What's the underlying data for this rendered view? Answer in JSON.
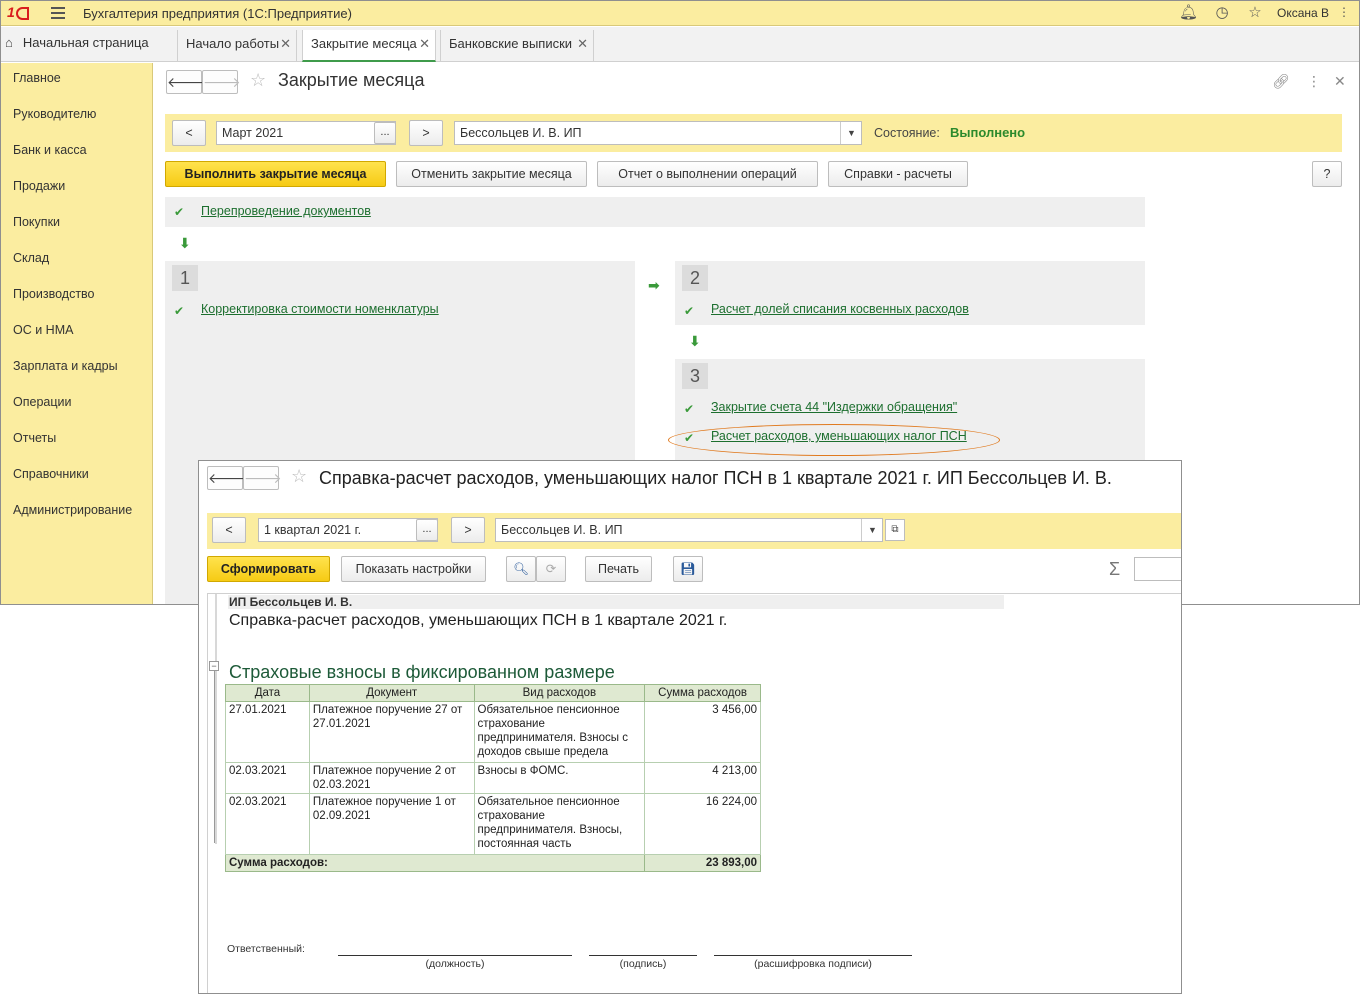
{
  "app": {
    "title": "Бухгалтерия предприятия  (1С:Предприятие)",
    "user": "Оксана В"
  },
  "tabs": [
    {
      "label": "Начальная страница"
    },
    {
      "label": "Начало работы"
    },
    {
      "label": "Закрытие месяца"
    },
    {
      "label": "Банковские выписки"
    }
  ],
  "sidebar": {
    "items": [
      {
        "label": "Главное"
      },
      {
        "label": "Руководителю"
      },
      {
        "label": "Банк и касса"
      },
      {
        "label": "Продажи"
      },
      {
        "label": "Покупки"
      },
      {
        "label": "Склад"
      },
      {
        "label": "Производство"
      },
      {
        "label": "ОС и НМА"
      },
      {
        "label": "Зарплата и кадры"
      },
      {
        "label": "Операции"
      },
      {
        "label": "Отчеты"
      },
      {
        "label": "Справочники"
      },
      {
        "label": "Администрирование"
      }
    ]
  },
  "closing": {
    "title": "Закрытие месяца",
    "period": "Март 2021",
    "organization": "Бессольцев И. В. ИП",
    "status_label": "Состояние:",
    "status_value": "Выполнено",
    "buttons": {
      "run": "Выполнить закрытие месяца",
      "cancel": "Отменить закрытие месяца",
      "report": "Отчет о выполнении операций",
      "refs": "Справки - расчеты",
      "help": "?"
    },
    "prev": "<",
    "next": ">",
    "ellipsis": "...",
    "step0": {
      "op": "Перепроведение документов"
    },
    "step1": {
      "num": "1",
      "op": "Корректировка стоимости номенклатуры"
    },
    "step2": {
      "num": "2",
      "op": "Расчет долей списания косвенных расходов"
    },
    "step3": {
      "num": "3",
      "ops": [
        "Закрытие счета 44 \"Издержки обращения\"",
        "Расчет расходов, уменьшающих налог ПСН"
      ]
    }
  },
  "report": {
    "window_title": "Справка-расчет расходов, уменьшающих налог ПСН в 1 квартале 2021 г. ИП Бессольцев И. В.",
    "period": "1 квартал 2021 г.",
    "organization": "Бессольцев И. В. ИП",
    "buttons": {
      "generate": "Сформировать",
      "settings": "Показать настройки",
      "print": "Печать"
    },
    "prev": "<",
    "next": ">",
    "ellipsis": "...",
    "org_header": "ИП Бессольцев И. В.",
    "doc_title": "Справка-расчет расходов, уменьшающих ПСН в 1 квартале 2021 г.",
    "section_title": "Страховые взносы в фиксированном размере",
    "columns": [
      "Дата",
      "Документ",
      "Вид расходов",
      "Сумма расходов"
    ],
    "rows": [
      {
        "date": "27.01.2021",
        "doc": "Платежное поручение 27 от 27.01.2021",
        "kind": "Обязательное пенсионное страхование предпринимателя. Взносы с доходов свыше предела",
        "sum": "3 456,00"
      },
      {
        "date": "02.03.2021",
        "doc": "Платежное поручение 2 от 02.03.2021",
        "kind": "Взносы в ФОМС.",
        "sum": "4 213,00"
      },
      {
        "date": "02.03.2021",
        "doc": "Платежное поручение 1 от 02.09.2021",
        "kind": "Обязательное пенсионное страхование предпринимателя. Взносы, постоянная часть",
        "sum": "16 224,00"
      }
    ],
    "total_label": "Сумма расходов:",
    "total_value": "23 893,00",
    "signature": {
      "label": "Ответственный:",
      "cap_position": "(должность)",
      "cap_sign": "(подпись)",
      "cap_decode": "(расшифровка подписи)"
    }
  }
}
